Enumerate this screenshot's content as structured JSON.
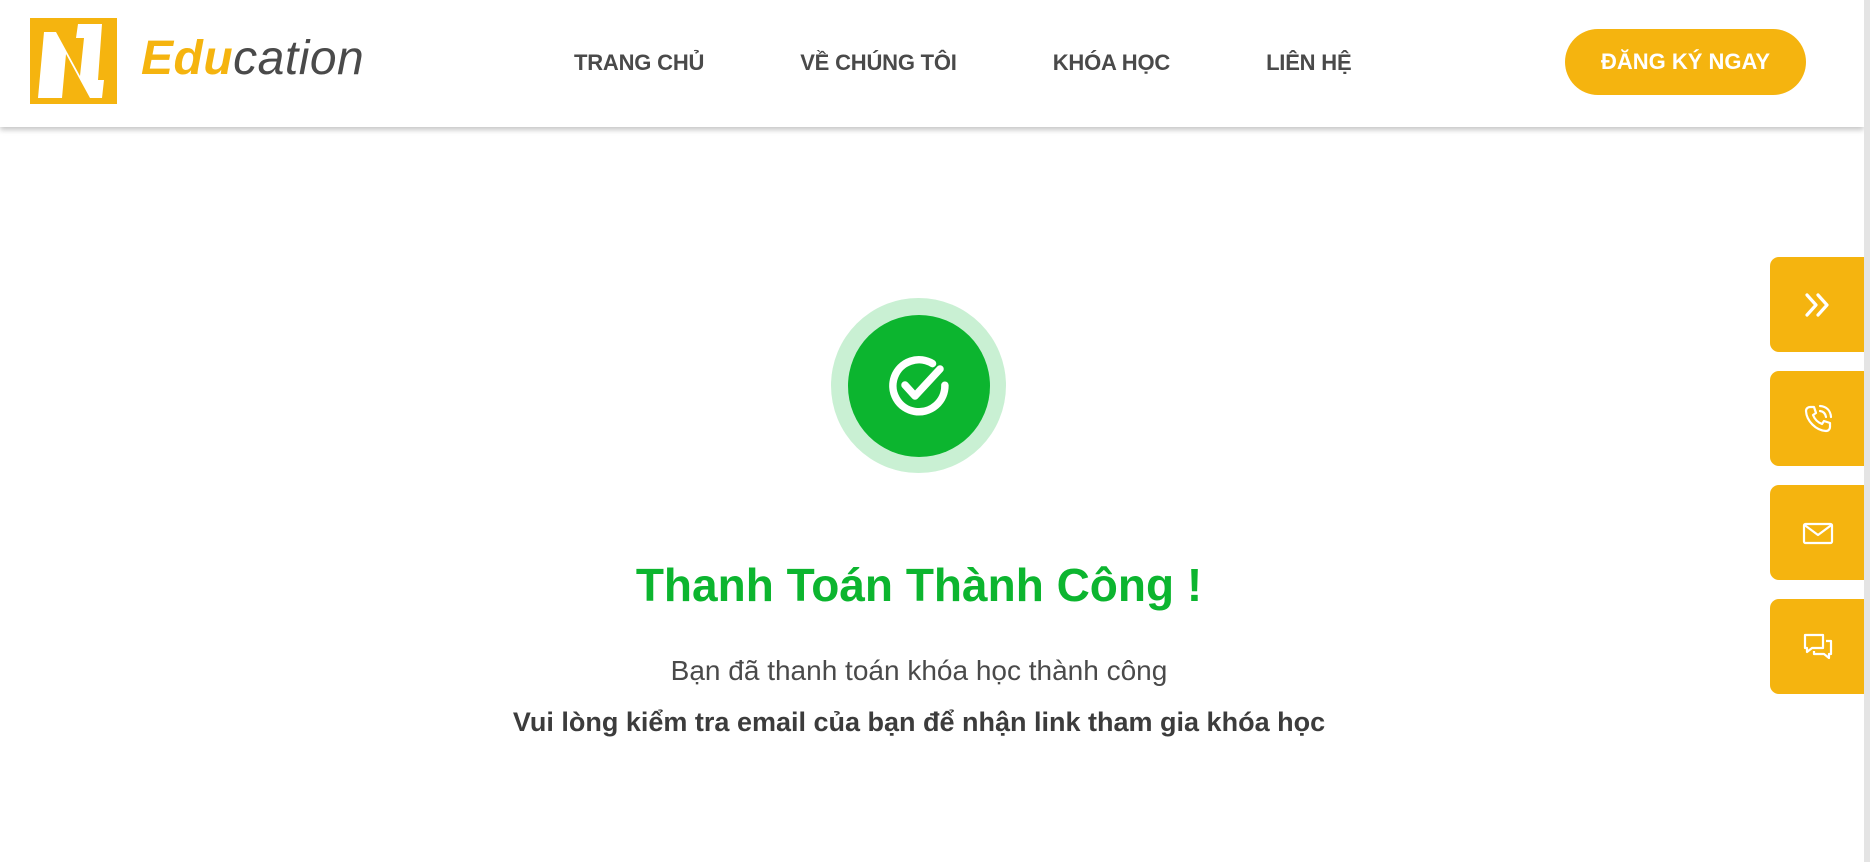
{
  "brand": {
    "logo_letter": "N",
    "name_part1": "Edu",
    "name_part2": "cation",
    "accent_color": "#f5b40f",
    "text_color": "#4a4a4a"
  },
  "nav": {
    "items": [
      {
        "label": "TRANG CHỦ"
      },
      {
        "label": "VỀ CHÚNG TÔI"
      },
      {
        "label": "KHÓA HỌC"
      },
      {
        "label": "LIÊN HỆ"
      }
    ]
  },
  "header": {
    "cta_label": "ĐĂNG KÝ NGAY"
  },
  "success": {
    "icon": "check-circle-icon",
    "title": "Thanh Toán Thành Công !",
    "subtitle": "Bạn đã thanh toán khóa học thành công",
    "note": "Vui lòng kiểm tra email của bạn để nhận link tham gia khóa học",
    "color": "#0cb52f",
    "ring_color": "#c9f0d3"
  },
  "side_buttons": [
    {
      "icon": "double-chevron-right-icon"
    },
    {
      "icon": "phone-icon"
    },
    {
      "icon": "mail-icon"
    },
    {
      "icon": "chat-icon"
    }
  ]
}
